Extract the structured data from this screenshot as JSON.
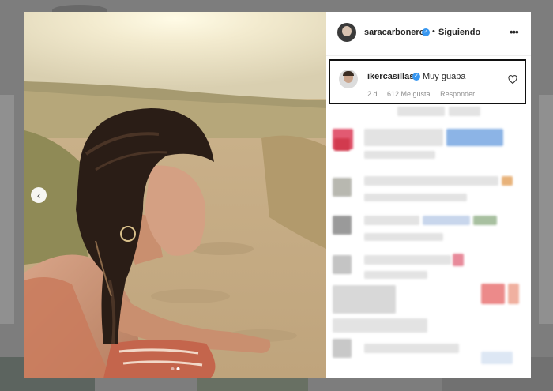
{
  "post": {
    "author": "saracarbonero",
    "separator": "•",
    "follow_status": "Siguiendo",
    "more_glyph": "•••",
    "prev_glyph": "‹",
    "icons": [
      "chevron-left-icon",
      "verified-icon",
      "more-options-icon",
      "heart-icon"
    ],
    "carousel": {
      "slides": 2,
      "active": 1
    }
  },
  "comment": {
    "username": "ikercasillas",
    "text": "Muy guapa",
    "age": "2 d",
    "likes": "612 Me gusta",
    "reply_label": "Responder"
  },
  "colors": {
    "verified": "#3897f0",
    "highlight_border": "#111111",
    "meta_text": "#8e8e8e"
  }
}
